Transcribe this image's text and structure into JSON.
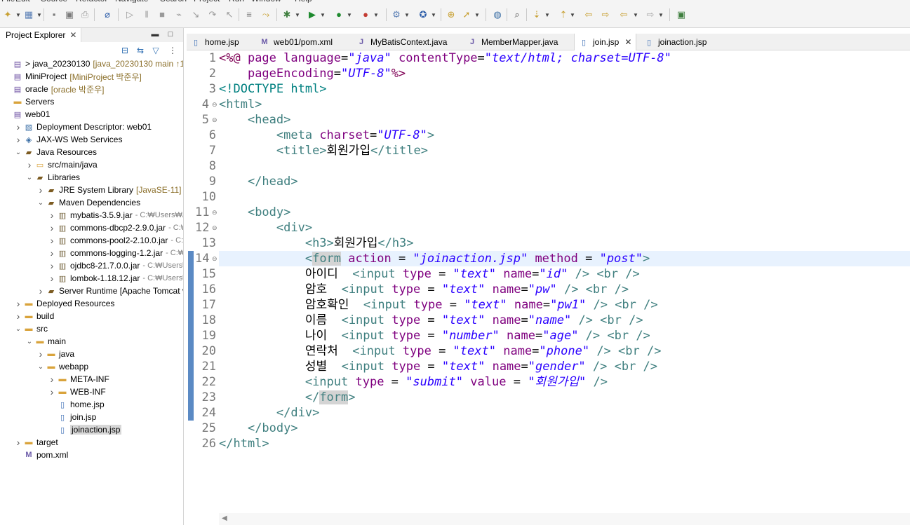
{
  "menu": [
    "File",
    "Edit",
    "Source",
    "Refactor",
    "Navigate",
    "Search",
    "Project",
    "Run",
    "Window",
    "Help"
  ],
  "explorer": {
    "tab_label": "Project Explorer",
    "tree": [
      {
        "label": "> java_20230130",
        "deco": "[java_20230130 main ↑1",
        "icon": "project-icon",
        "twisty": "",
        "depth": 0
      },
      {
        "label": "MiniProject",
        "deco": "[MiniProject 박준우]",
        "icon": "project-icon",
        "twisty": "",
        "depth": 0
      },
      {
        "label": "oracle",
        "deco": "[oracle 박준우]",
        "icon": "project-icon",
        "twisty": "",
        "depth": 0
      },
      {
        "label": "Servers",
        "deco": "",
        "icon": "folder-icon",
        "twisty": "",
        "depth": 0
      },
      {
        "label": "web01",
        "deco": "",
        "icon": "project-icon",
        "twisty": "",
        "depth": 0
      },
      {
        "label": "Deployment Descriptor: web01",
        "deco": "",
        "icon": "descriptor-icon",
        "twisty": ">",
        "depth": 1
      },
      {
        "label": "JAX-WS Web Services",
        "deco": "",
        "icon": "webservice-icon",
        "twisty": ">",
        "depth": 1
      },
      {
        "label": "Java Resources",
        "deco": "",
        "icon": "java-resources-icon",
        "twisty": "v",
        "depth": 1
      },
      {
        "label": "src/main/java",
        "deco": "",
        "icon": "source-folder-icon",
        "twisty": ">",
        "depth": 2
      },
      {
        "label": "Libraries",
        "deco": "",
        "icon": "library-icon",
        "twisty": "v",
        "depth": 2
      },
      {
        "label": "JRE System Library",
        "deco": "[JavaSE-11]",
        "icon": "library-icon",
        "twisty": ">",
        "depth": 3
      },
      {
        "label": "Maven Dependencies",
        "deco": "",
        "icon": "library-icon",
        "twisty": "v",
        "depth": 3
      },
      {
        "label": "mybatis-3.5.9.jar",
        "deco": "- C:₩Users₩A",
        "icon": "jar-icon",
        "twisty": ">",
        "depth": 4
      },
      {
        "label": "commons-dbcp2-2.9.0.jar",
        "deco": "- C:₩",
        "icon": "jar-icon",
        "twisty": ">",
        "depth": 4
      },
      {
        "label": "commons-pool2-2.10.0.jar",
        "deco": "- C:₩",
        "icon": "jar-icon",
        "twisty": ">",
        "depth": 4
      },
      {
        "label": "commons-logging-1.2.jar",
        "deco": "- C:₩U",
        "icon": "jar-icon",
        "twisty": ">",
        "depth": 4
      },
      {
        "label": "ojdbc8-21.7.0.0.jar",
        "deco": "- C:₩Users₩",
        "icon": "jar-icon",
        "twisty": ">",
        "depth": 4
      },
      {
        "label": "lombok-1.18.12.jar",
        "deco": "- C:₩Users₩",
        "icon": "jar-icon",
        "twisty": ">",
        "depth": 4
      },
      {
        "label": "Server Runtime [Apache Tomcat v",
        "deco": "",
        "icon": "library-icon",
        "twisty": ">",
        "depth": 3
      },
      {
        "label": "Deployed Resources",
        "deco": "",
        "icon": "folder-icon",
        "twisty": ">",
        "depth": 1
      },
      {
        "label": "build",
        "deco": "",
        "icon": "folder-icon",
        "twisty": ">",
        "depth": 1
      },
      {
        "label": "src",
        "deco": "",
        "icon": "folder-icon",
        "twisty": "v",
        "depth": 1
      },
      {
        "label": "main",
        "deco": "",
        "icon": "folder-icon",
        "twisty": "v",
        "depth": 2
      },
      {
        "label": "java",
        "deco": "",
        "icon": "folder-icon",
        "twisty": ">",
        "depth": 3
      },
      {
        "label": "webapp",
        "deco": "",
        "icon": "folder-icon",
        "twisty": "v",
        "depth": 3
      },
      {
        "label": "META-INF",
        "deco": "",
        "icon": "folder-icon",
        "twisty": ">",
        "depth": 4
      },
      {
        "label": "WEB-INF",
        "deco": "",
        "icon": "folder-icon",
        "twisty": ">",
        "depth": 4
      },
      {
        "label": "home.jsp",
        "deco": "",
        "icon": "jsp-file-icon",
        "twisty": "",
        "depth": 4
      },
      {
        "label": "join.jsp",
        "deco": "",
        "icon": "jsp-file-icon",
        "twisty": "",
        "depth": 4
      },
      {
        "label": "joinaction.jsp",
        "deco": "",
        "icon": "jsp-file-icon",
        "twisty": "",
        "depth": 4,
        "selected": true
      },
      {
        "label": "target",
        "deco": "",
        "icon": "folder-icon",
        "twisty": ">",
        "depth": 1
      },
      {
        "label": "pom.xml",
        "deco": "",
        "icon": "xml-file-icon",
        "twisty": "",
        "depth": 1
      }
    ]
  },
  "editor": {
    "tabs": [
      {
        "label": "home.jsp",
        "icon": "jsp-file-icon",
        "active": false
      },
      {
        "label": "web01/pom.xml",
        "icon": "xml-file-icon",
        "active": false
      },
      {
        "label": "MyBatisContext.java",
        "icon": "java-file-icon",
        "active": false
      },
      {
        "label": "MemberMapper.java",
        "icon": "java-file-icon",
        "active": false
      },
      {
        "label": "join.jsp",
        "icon": "jsp-file-icon",
        "active": true
      },
      {
        "label": "joinaction.jsp",
        "icon": "jsp-file-icon",
        "active": false
      }
    ],
    "current_line": 14,
    "lines": [
      {
        "n": "1",
        "fold": "",
        "tokens": [
          [
            "jsp",
            "<%@ "
          ],
          [
            "attr",
            "page "
          ],
          [
            "attr",
            "language"
          ],
          [
            "plain",
            "="
          ],
          [
            "str",
            "\"java\""
          ],
          [
            "plain",
            " "
          ],
          [
            "attr",
            "contentType"
          ],
          [
            "plain",
            "="
          ],
          [
            "str",
            "\"text/html; charset=UTF-8\""
          ]
        ]
      },
      {
        "n": "2",
        "fold": "",
        "tokens": [
          [
            "plain",
            "    "
          ],
          [
            "attr",
            "pageEncoding"
          ],
          [
            "plain",
            "="
          ],
          [
            "str",
            "\"UTF-8\""
          ],
          [
            "jsp",
            "%>"
          ]
        ]
      },
      {
        "n": "3",
        "fold": "",
        "tokens": [
          [
            "doc",
            "<!DOCTYPE html>"
          ]
        ]
      },
      {
        "n": "4",
        "fold": "⊖",
        "tokens": [
          [
            "tag",
            "<html>"
          ]
        ]
      },
      {
        "n": "5",
        "fold": "⊖",
        "tokens": [
          [
            "plain",
            "    "
          ],
          [
            "tag",
            "<head>"
          ]
        ]
      },
      {
        "n": "6",
        "fold": "",
        "tokens": [
          [
            "plain",
            "        "
          ],
          [
            "tag",
            "<meta "
          ],
          [
            "attr",
            "charset"
          ],
          [
            "plain",
            "="
          ],
          [
            "str",
            "\"UTF-8\""
          ],
          [
            "tag",
            ">"
          ]
        ]
      },
      {
        "n": "7",
        "fold": "",
        "tokens": [
          [
            "plain",
            "        "
          ],
          [
            "tag",
            "<title>"
          ],
          [
            "plain",
            "회원가입"
          ],
          [
            "tag",
            "</title>"
          ]
        ]
      },
      {
        "n": "8",
        "fold": "",
        "tokens": [
          [
            "plain",
            ""
          ]
        ]
      },
      {
        "n": "9",
        "fold": "",
        "tokens": [
          [
            "plain",
            "    "
          ],
          [
            "tag",
            "</head>"
          ]
        ]
      },
      {
        "n": "10",
        "fold": "",
        "tokens": [
          [
            "plain",
            ""
          ]
        ]
      },
      {
        "n": "11",
        "fold": "⊖",
        "tokens": [
          [
            "plain",
            "    "
          ],
          [
            "tag",
            "<body>"
          ]
        ]
      },
      {
        "n": "12",
        "fold": "⊖",
        "tokens": [
          [
            "plain",
            "        "
          ],
          [
            "tag",
            "<div>"
          ]
        ]
      },
      {
        "n": "13",
        "fold": "",
        "tokens": [
          [
            "plain",
            "            "
          ],
          [
            "tag",
            "<h3>"
          ],
          [
            "plain",
            "회원가입"
          ],
          [
            "tag",
            "</h3>"
          ]
        ]
      },
      {
        "n": "14",
        "fold": "⊖",
        "tokens": [
          [
            "plain",
            "            "
          ],
          [
            "tag",
            "<"
          ],
          [
            "taghl",
            "form"
          ],
          [
            "plain",
            " "
          ],
          [
            "attr",
            "action"
          ],
          [
            "plain",
            " = "
          ],
          [
            "str",
            "\"joinaction.jsp\""
          ],
          [
            "plain",
            " "
          ],
          [
            "attr",
            "method"
          ],
          [
            "plain",
            " = "
          ],
          [
            "str",
            "\"post\""
          ],
          [
            "tag",
            ">"
          ]
        ]
      },
      {
        "n": "15",
        "fold": "",
        "tokens": [
          [
            "plain",
            "            아이디  "
          ],
          [
            "tag",
            "<input "
          ],
          [
            "attr",
            "type"
          ],
          [
            "plain",
            " = "
          ],
          [
            "str",
            "\"text\""
          ],
          [
            "plain",
            " "
          ],
          [
            "attr",
            "name"
          ],
          [
            "plain",
            "="
          ],
          [
            "str",
            "\"id\""
          ],
          [
            "tag",
            " /> <br />"
          ]
        ]
      },
      {
        "n": "16",
        "fold": "",
        "tokens": [
          [
            "plain",
            "            암호  "
          ],
          [
            "tag",
            "<input "
          ],
          [
            "attr",
            "type"
          ],
          [
            "plain",
            " = "
          ],
          [
            "str",
            "\"text\""
          ],
          [
            "plain",
            " "
          ],
          [
            "attr",
            "name"
          ],
          [
            "plain",
            "="
          ],
          [
            "str",
            "\"pw\""
          ],
          [
            "tag",
            " /> <br />"
          ]
        ]
      },
      {
        "n": "17",
        "fold": "",
        "tokens": [
          [
            "plain",
            "            암호확인  "
          ],
          [
            "tag",
            "<input "
          ],
          [
            "attr",
            "type"
          ],
          [
            "plain",
            " = "
          ],
          [
            "str",
            "\"text\""
          ],
          [
            "plain",
            " "
          ],
          [
            "attr",
            "name"
          ],
          [
            "plain",
            "="
          ],
          [
            "str",
            "\"pw1\""
          ],
          [
            "tag",
            " /> <br />"
          ]
        ]
      },
      {
        "n": "18",
        "fold": "",
        "tokens": [
          [
            "plain",
            "            이름  "
          ],
          [
            "tag",
            "<input "
          ],
          [
            "attr",
            "type"
          ],
          [
            "plain",
            " = "
          ],
          [
            "str",
            "\"text\""
          ],
          [
            "plain",
            " "
          ],
          [
            "attr",
            "name"
          ],
          [
            "plain",
            "="
          ],
          [
            "str",
            "\"name\""
          ],
          [
            "tag",
            " /> <br />"
          ]
        ]
      },
      {
        "n": "19",
        "fold": "",
        "tokens": [
          [
            "plain",
            "            나이  "
          ],
          [
            "tag",
            "<input "
          ],
          [
            "attr",
            "type"
          ],
          [
            "plain",
            " = "
          ],
          [
            "str",
            "\"number\""
          ],
          [
            "plain",
            " "
          ],
          [
            "attr",
            "name"
          ],
          [
            "plain",
            "="
          ],
          [
            "str",
            "\"age\""
          ],
          [
            "tag",
            " /> <br />"
          ]
        ]
      },
      {
        "n": "20",
        "fold": "",
        "tokens": [
          [
            "plain",
            "            연락처  "
          ],
          [
            "tag",
            "<input "
          ],
          [
            "attr",
            "type"
          ],
          [
            "plain",
            " = "
          ],
          [
            "str",
            "\"text\""
          ],
          [
            "plain",
            " "
          ],
          [
            "attr",
            "name"
          ],
          [
            "plain",
            "="
          ],
          [
            "str",
            "\"phone\""
          ],
          [
            "tag",
            " /> <br />"
          ]
        ]
      },
      {
        "n": "21",
        "fold": "",
        "tokens": [
          [
            "plain",
            "            성별  "
          ],
          [
            "tag",
            "<input "
          ],
          [
            "attr",
            "type"
          ],
          [
            "plain",
            " = "
          ],
          [
            "str",
            "\"text\""
          ],
          [
            "plain",
            " "
          ],
          [
            "attr",
            "name"
          ],
          [
            "plain",
            "="
          ],
          [
            "str",
            "\"gender\""
          ],
          [
            "tag",
            " /> <br />"
          ]
        ]
      },
      {
        "n": "22",
        "fold": "",
        "tokens": [
          [
            "plain",
            "            "
          ],
          [
            "tag",
            "<input "
          ],
          [
            "attr",
            "type"
          ],
          [
            "plain",
            " = "
          ],
          [
            "str",
            "\"submit\""
          ],
          [
            "plain",
            " "
          ],
          [
            "attr",
            "value"
          ],
          [
            "plain",
            " = "
          ],
          [
            "str",
            "\"회원가입\""
          ],
          [
            "tag",
            " />"
          ]
        ]
      },
      {
        "n": "23",
        "fold": "",
        "tokens": [
          [
            "plain",
            "            "
          ],
          [
            "tag",
            "</"
          ],
          [
            "taghl",
            "form"
          ],
          [
            "tag",
            ">"
          ]
        ]
      },
      {
        "n": "24",
        "fold": "",
        "tokens": [
          [
            "plain",
            "        "
          ],
          [
            "tag",
            "</div>"
          ]
        ]
      },
      {
        "n": "25",
        "fold": "",
        "tokens": [
          [
            "plain",
            "    "
          ],
          [
            "tag",
            "</body>"
          ]
        ]
      },
      {
        "n": "26",
        "fold": "",
        "tokens": [
          [
            "tag",
            "</html>"
          ]
        ]
      }
    ]
  },
  "colors": {
    "tag": "#3f7f7f",
    "attribute": "#7f007f",
    "string": "#2a00ff",
    "jsp_delimiter": "#7f0055",
    "doctype": "#008080",
    "current_line_bg": "#e8f2fe",
    "change_bar": "#5b8ac4"
  }
}
